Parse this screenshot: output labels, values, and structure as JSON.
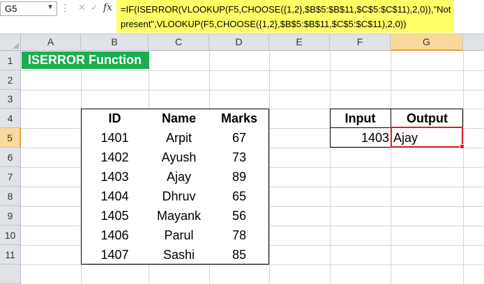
{
  "name_box": {
    "value": "G5"
  },
  "formula_bar": {
    "fx_label": "fx",
    "formula_line1": "=IF(ISERROR(VLOOKUP(F5,CHOOSE({1,2},$B$5:$B$11,$C$5:$C$11),2,0)),\"Not",
    "formula_line2": "present\",VLOOKUP(F5,CHOOSE({1,2},$B$5:$B$11,$C$5:$C$11),2,0))"
  },
  "columns": [
    "A",
    "B",
    "C",
    "D",
    "E",
    "F",
    "G"
  ],
  "selected_column": "G",
  "rows": [
    "1",
    "2",
    "3",
    "4",
    "5",
    "6",
    "7",
    "8",
    "9",
    "10",
    "11"
  ],
  "selected_row": "5",
  "title": "ISERROR Function",
  "table": {
    "headers": [
      "ID",
      "Name",
      "Marks"
    ],
    "rows": [
      [
        "1401",
        "Arpit",
        "67"
      ],
      [
        "1402",
        "Ayush",
        "73"
      ],
      [
        "1403",
        "Ajay",
        "89"
      ],
      [
        "1404",
        "Dhruv",
        "65"
      ],
      [
        "1405",
        "Mayank",
        "56"
      ],
      [
        "1406",
        "Parul",
        "78"
      ],
      [
        "1407",
        "Sashi",
        "85"
      ]
    ]
  },
  "lookup": {
    "input_header": "Input",
    "output_header": "Output",
    "input_value": "1403",
    "output_value": "Ajay"
  },
  "colors": {
    "title_bg": "#1aae4e",
    "formula_highlight": "#ffff66",
    "selected_cell_border": "#e01c24",
    "header_selected": "#f9d99b"
  }
}
